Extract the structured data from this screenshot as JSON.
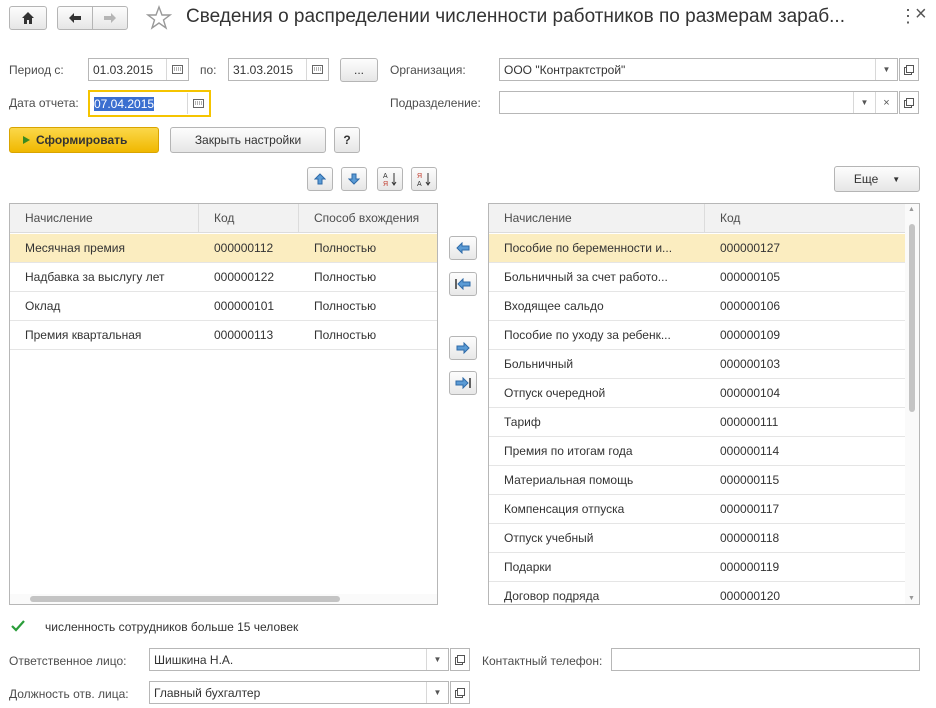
{
  "header": {
    "title": "Сведения о распределении численности работников по размерам зараб...",
    "more_glyph": "⋮",
    "close_glyph": "×"
  },
  "period": {
    "from_label": "Период с:",
    "from_value": "01.03.2015",
    "to_label": "по:",
    "to_value": "31.03.2015",
    "dots_label": "..."
  },
  "report_date": {
    "label": "Дата отчета:",
    "value": "07.04.2015"
  },
  "organization": {
    "label": "Организация:",
    "value": "ООО \"Контрактстрой\""
  },
  "department": {
    "label": "Подразделение:",
    "value": ""
  },
  "actions": {
    "generate_label": "Сформировать",
    "close_settings_label": "Закрыть настройки",
    "help_label": "?",
    "more_label": "Еще"
  },
  "left_table": {
    "columns": [
      "Начисление",
      "Код",
      "Способ вхождения"
    ],
    "rows": [
      {
        "name": "Месячная премия",
        "code": "000000112",
        "mode": "Полностью"
      },
      {
        "name": "Надбавка за выслугу лет",
        "code": "000000122",
        "mode": "Полностью"
      },
      {
        "name": "Оклад",
        "code": "000000101",
        "mode": "Полностью"
      },
      {
        "name": "Премия квартальная",
        "code": "000000113",
        "mode": "Полностью"
      }
    ]
  },
  "right_table": {
    "columns": [
      "Начисление",
      "Код"
    ],
    "rows": [
      {
        "name": "Пособие по беременности и...",
        "code": "000000127"
      },
      {
        "name": "Больничный за счет работо...",
        "code": "000000105"
      },
      {
        "name": "Входящее сальдо",
        "code": "000000106"
      },
      {
        "name": "Пособие по уходу за ребенк...",
        "code": "000000109"
      },
      {
        "name": "Больничный",
        "code": "000000103"
      },
      {
        "name": "Отпуск очередной",
        "code": "000000104"
      },
      {
        "name": "Тариф",
        "code": "000000111"
      },
      {
        "name": "Премия по итогам года",
        "code": "000000114"
      },
      {
        "name": "Материальная помощь",
        "code": "000000115"
      },
      {
        "name": "Компенсация отпуска",
        "code": "000000117"
      },
      {
        "name": "Отпуск учебный",
        "code": "000000118"
      },
      {
        "name": "Подарки",
        "code": "000000119"
      },
      {
        "name": "Договор подряда",
        "code": "000000120"
      }
    ]
  },
  "checkbox": {
    "label": "численность сотрудников больше 15 человек",
    "checked": true
  },
  "responsible": {
    "label": "Ответственное лицо:",
    "value": "Шишкина Н.А."
  },
  "phone": {
    "label": "Контактный телефон:",
    "value": ""
  },
  "position": {
    "label": "Должность отв. лица:",
    "value": "Главный бухгалтер"
  },
  "colors": {
    "accent_yellow": "#f5c400",
    "selection": "#fbedc0",
    "check_green": "#2a9d3a"
  }
}
